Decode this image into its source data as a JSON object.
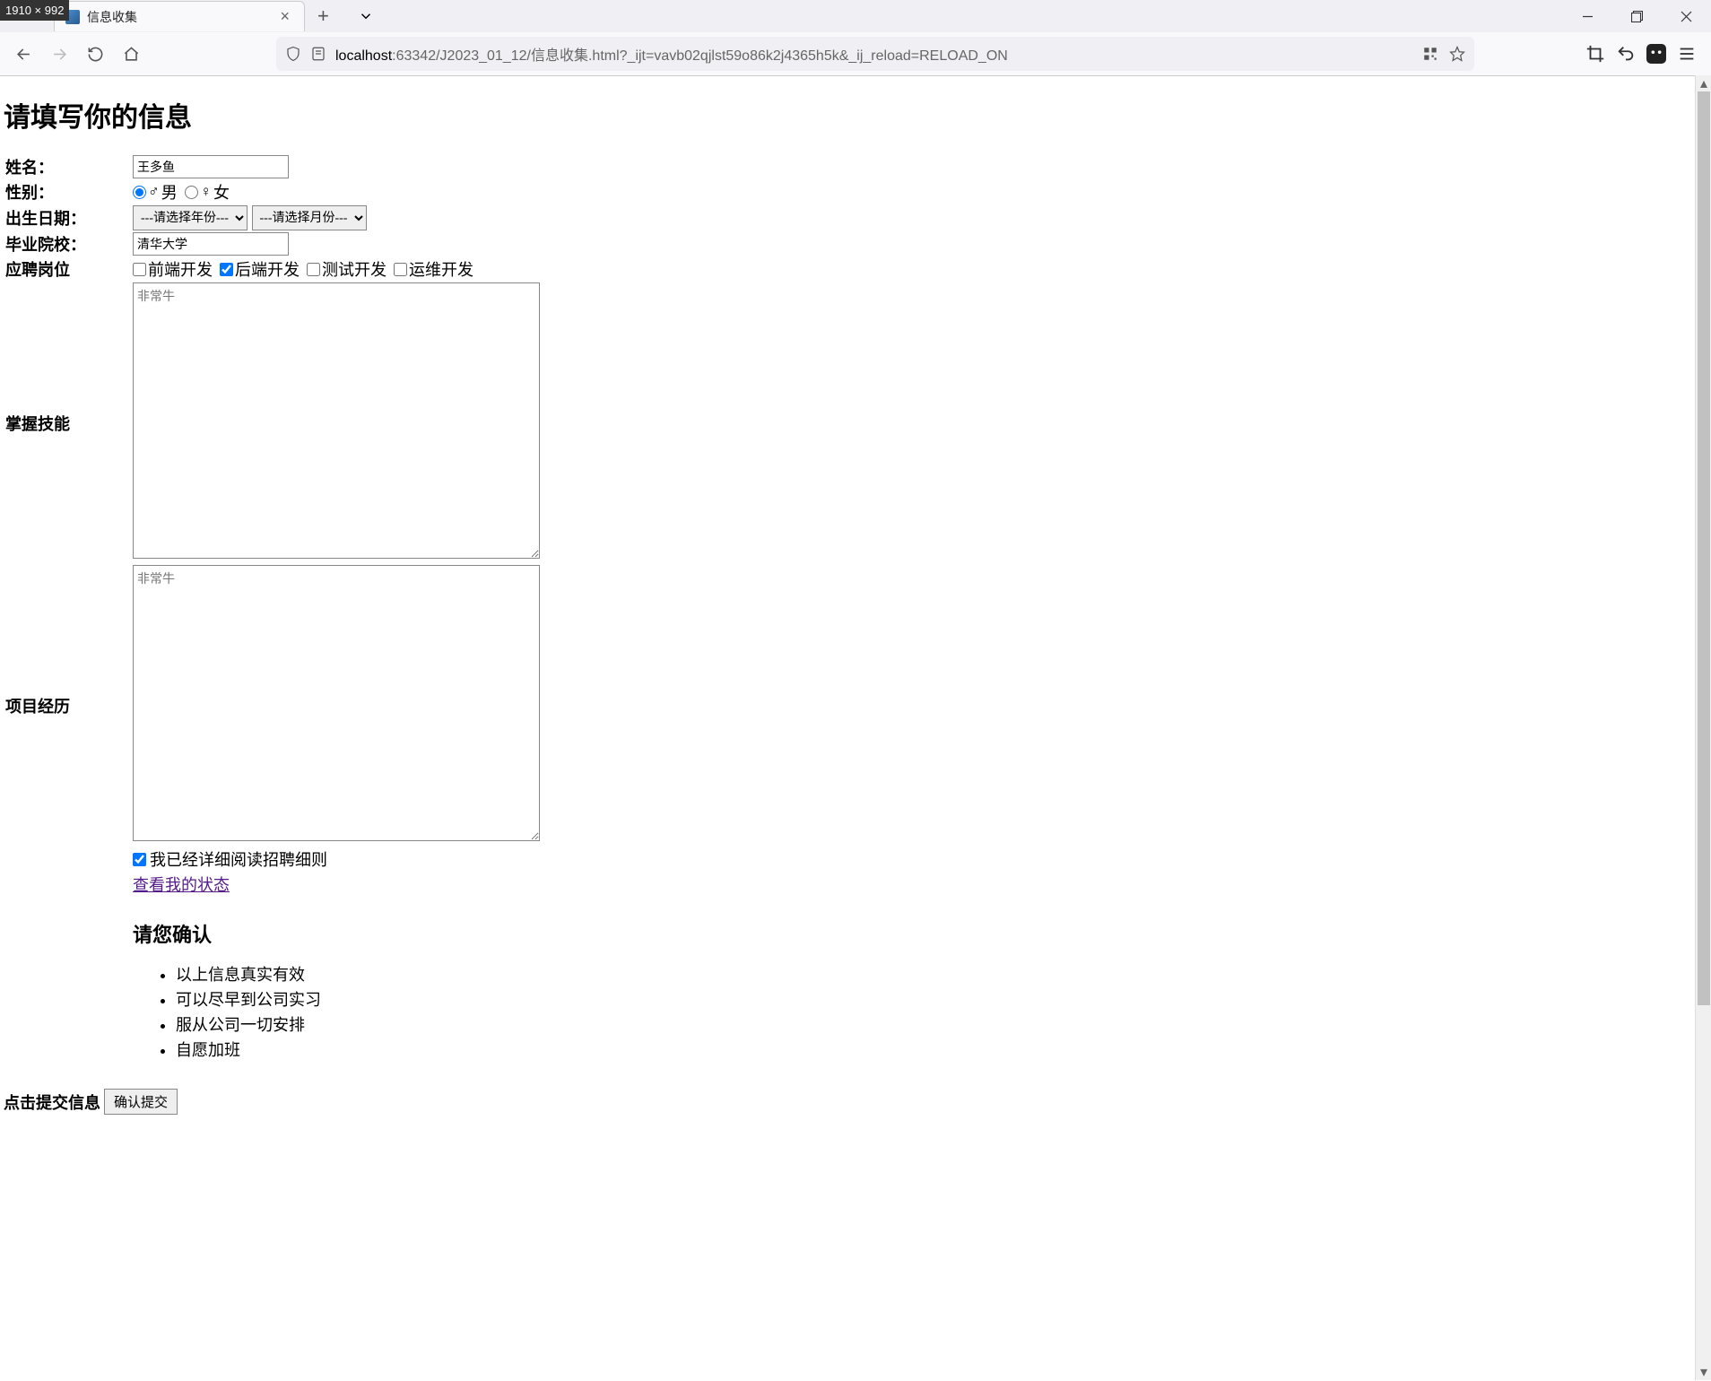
{
  "browser": {
    "dim_badge": "1910 × 992",
    "tab_title": "信息收集",
    "url_prefix": "localhost",
    "url_rest": ":63342/J2023_01_12/信息收集.html?_ijt=vavb02qjlst59o86k2j4365h5k&_ij_reload=RELOAD_ON"
  },
  "page": {
    "title": "请填写你的信息",
    "labels": {
      "name": "姓名：",
      "gender": "性别：",
      "birth": "出生日期：",
      "school": "毕业院校：",
      "position": "应聘岗位",
      "skills": "掌握技能",
      "projects": "项目经历"
    },
    "values": {
      "name": "王多鱼",
      "school": "清华大学"
    },
    "gender": {
      "male": "男",
      "female": "女",
      "selected": "male"
    },
    "birth": {
      "year_placeholder": "---请选择年份---",
      "month_placeholder": "---请选择月份---"
    },
    "positions": [
      {
        "label": "前端开发",
        "checked": false
      },
      {
        "label": "后端开发",
        "checked": true
      },
      {
        "label": "测试开发",
        "checked": false
      },
      {
        "label": "运维开发",
        "checked": false
      }
    ],
    "skills_placeholder": "非常牛",
    "projects_placeholder": "非常牛",
    "agree_label": "我已经详细阅读招聘细则",
    "agree_checked": true,
    "status_link": "查看我的状态",
    "confirm_title": "请您确认",
    "confirm_items": [
      "以上信息真实有效",
      "可以尽早到公司实习",
      "服从公司一切安排",
      "自愿加班"
    ],
    "submit_label": "点击提交信息",
    "submit_button": "确认提交"
  }
}
